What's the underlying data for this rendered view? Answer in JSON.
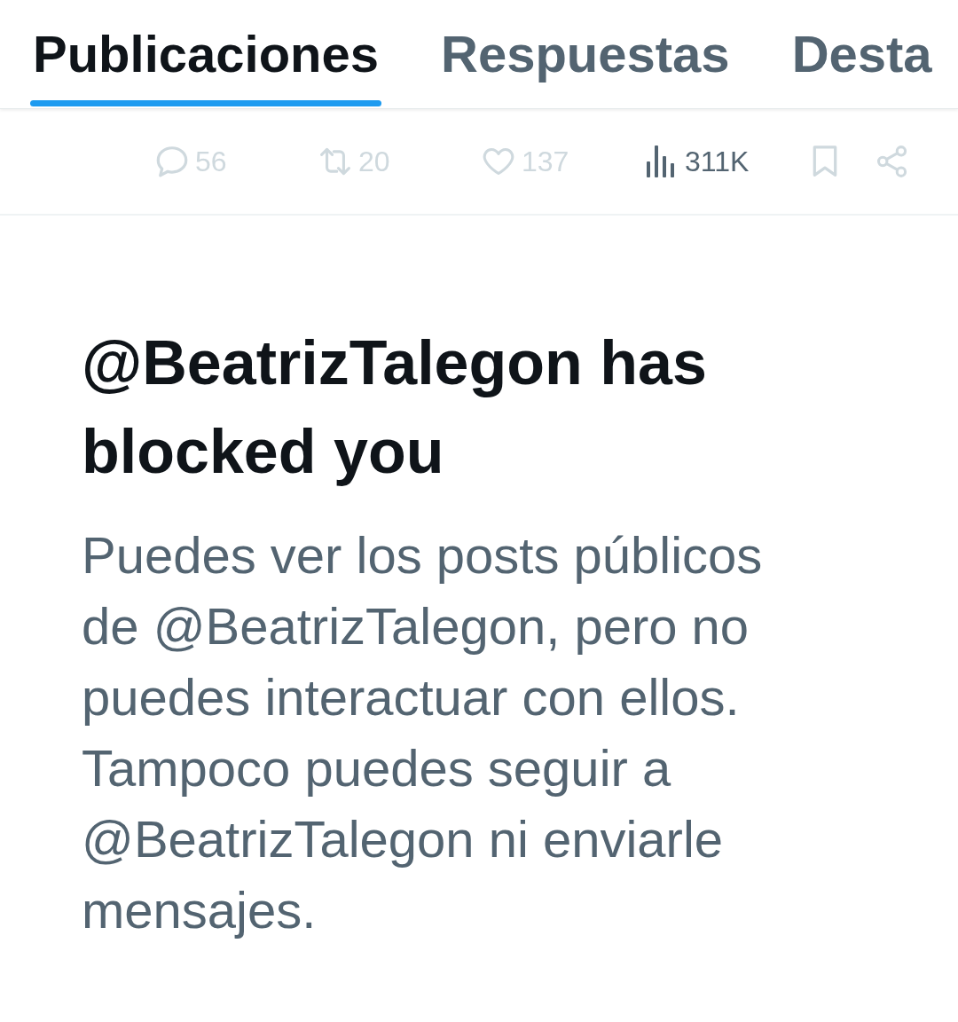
{
  "tabs": [
    {
      "label": "Publicaciones",
      "selected": true
    },
    {
      "label": "Respuestas",
      "selected": false
    },
    {
      "label": "Desta",
      "selected": false
    }
  ],
  "post_actions": [
    {
      "kind": "reply",
      "count": "56",
      "disabled": true
    },
    {
      "kind": "repost",
      "count": "20",
      "disabled": true
    },
    {
      "kind": "like",
      "count": "137",
      "disabled": true
    },
    {
      "kind": "views",
      "count": "311K",
      "disabled": false
    },
    {
      "kind": "bookmark",
      "disabled": true
    },
    {
      "kind": "share",
      "disabled": true
    }
  ],
  "blocked_notice": {
    "title": "@BeatrizTalegon has blocked you",
    "message": "Puedes ver los posts públicos de @BeatrizTalegon, pero no puedes interactuar con ellos. Tampoco puedes seguir a @BeatrizTalegon ni enviarle mensajes."
  }
}
